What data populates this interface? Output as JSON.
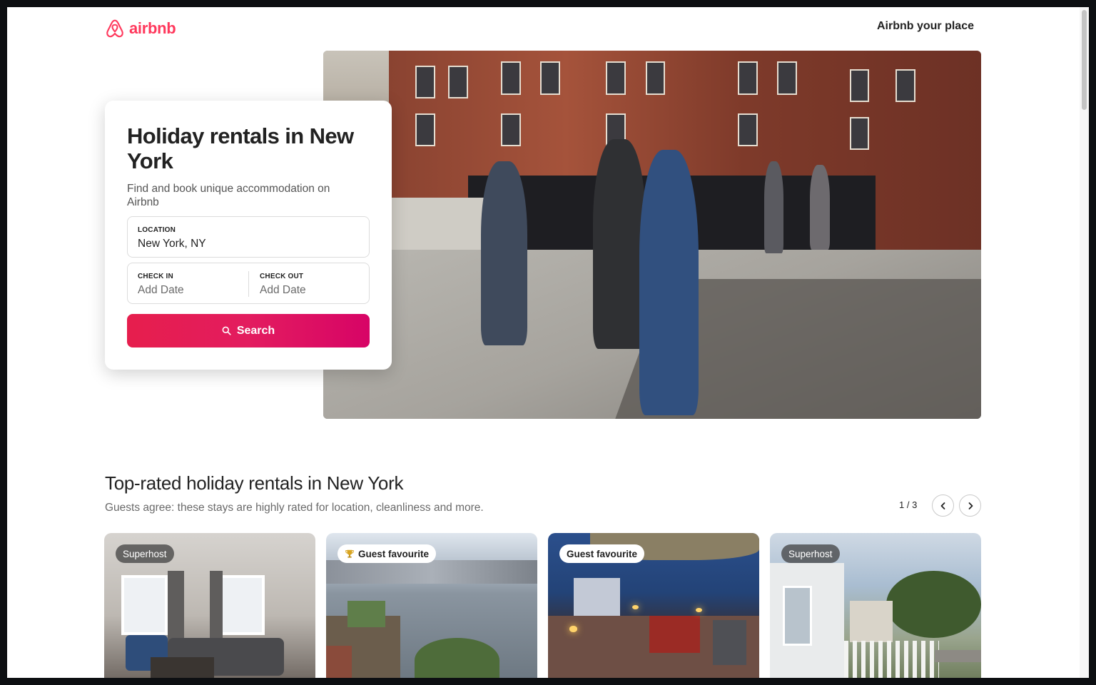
{
  "header": {
    "logo_text": "airbnb",
    "host_link": "Airbnb your place"
  },
  "hero": {
    "title": "Holiday rentals in New York",
    "subtitle": "Find and book unique accommodation on Airbnb",
    "location_label": "LOCATION",
    "location_value": "New York, NY",
    "checkin_label": "CHECK IN",
    "checkin_placeholder": "Add Date",
    "checkout_label": "CHECK OUT",
    "checkout_placeholder": "Add Date",
    "search_label": "Search"
  },
  "section": {
    "title": "Top-rated holiday rentals in New York",
    "subtitle": "Guests agree: these stays are highly rated for location, cleanliness and more.",
    "pager": "1 / 3"
  },
  "listings": [
    {
      "badge": "Superhost"
    },
    {
      "badge": "Guest favourite"
    },
    {
      "badge": "Guest favourite"
    },
    {
      "badge": "Superhost"
    }
  ],
  "colors": {
    "brand": "#ff385c",
    "button_start": "#e61e4d",
    "button_end": "#d70466"
  }
}
